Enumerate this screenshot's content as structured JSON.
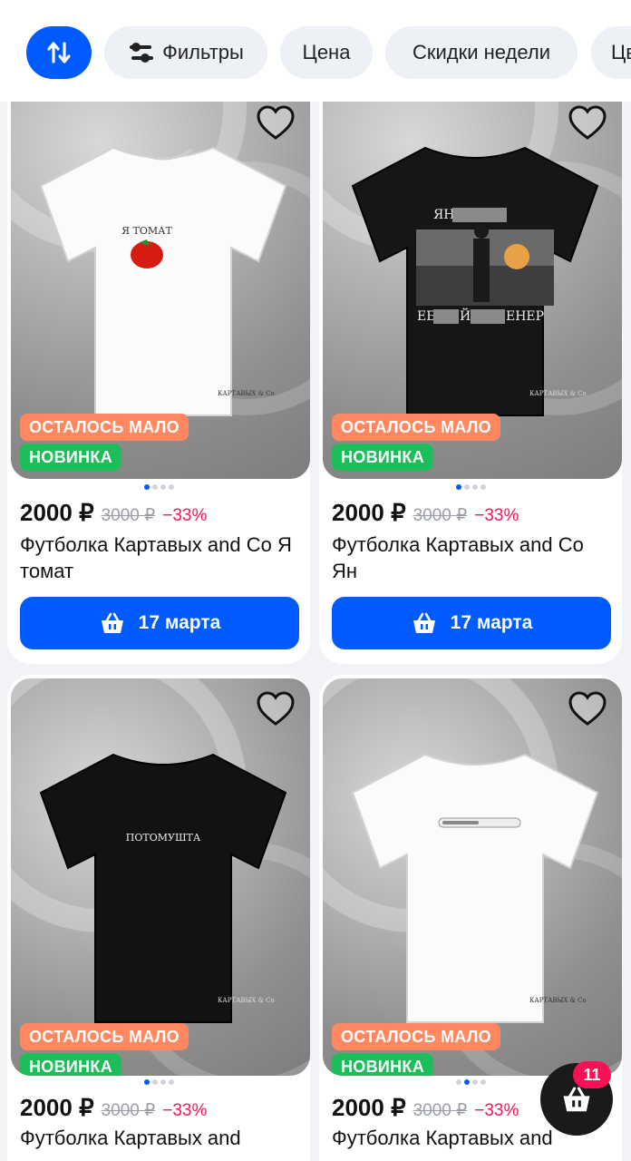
{
  "filters": {
    "sort_icon": "sort-arrows-icon",
    "filters_label": "Фильтры",
    "price_label": "Цена",
    "weekly_label": "Скидки недели",
    "more_label": "Цв"
  },
  "products": [
    {
      "badge_low": "ОСТАЛОСЬ МАЛО",
      "badge_new": "НОВИНКА",
      "price": "2000 ₽",
      "old_price": "3000 ₽",
      "discount": "−33%",
      "title": "Футболка Картавых and Co Я томат",
      "delivery": "17 марта",
      "shirt_color": "white",
      "print_text": "Я ТОМАТ",
      "brand": "КАРТАВЫХ & Co",
      "image_index": 1,
      "image_count": 4
    },
    {
      "badge_low": "ОСТАЛОСЬ МАЛО",
      "badge_new": "НОВИНКА",
      "price": "2000 ₽",
      "old_price": "3000 ₽",
      "discount": "−33%",
      "title": "Футболка Картавых and Co Ян",
      "delivery": "17 марта",
      "shirt_color": "black",
      "print_text_top": "ЯН",
      "print_text_bottom_a": "ЕБ",
      "print_text_bottom_b": "Й",
      "print_text_bottom_c": "ЕНЕР",
      "brand": "КАРТАВЫХ & Co",
      "image_index": 1,
      "image_count": 4
    },
    {
      "badge_low": "ОСТАЛОСЬ МАЛО",
      "badge_new": "НОВИНКА",
      "price": "2000 ₽",
      "old_price": "3000 ₽",
      "discount": "−33%",
      "title": "Футболка Картавых and",
      "shirt_color": "black",
      "print_text": "ПОТОМУШТА",
      "brand": "КАРТАВЫХ & Co",
      "image_index": 1,
      "image_count": 4
    },
    {
      "badge_low": "ОСТАЛОСЬ МАЛО",
      "badge_new": "НОВИНКА",
      "price": "2000 ₽",
      "old_price": "3000 ₽",
      "discount": "−33%",
      "title": "Футболка Картавых and",
      "shirt_color": "white",
      "brand": "КАРТАВЫХ & Co",
      "image_index": 2,
      "image_count": 4
    }
  ],
  "cart": {
    "count": "11",
    "icon": "basket-icon"
  },
  "colors": {
    "accent": "#005bff",
    "discount": "#f91155",
    "badge_low": "#ff8860",
    "badge_new": "#1dbe5a"
  }
}
